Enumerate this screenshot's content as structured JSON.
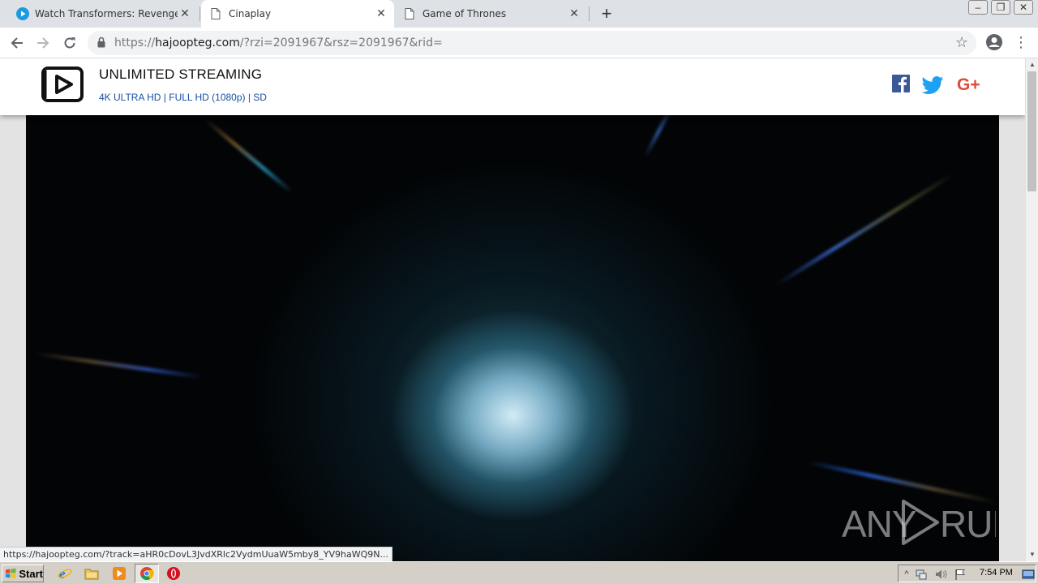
{
  "browser": {
    "tabs": [
      {
        "title": "Watch Transformers: Revenge Of Th",
        "icon": "play-circle-icon",
        "active": false
      },
      {
        "title": "Cinaplay",
        "icon": "page-icon",
        "active": true
      },
      {
        "title": "Game of Thrones",
        "icon": "page-icon",
        "active": false
      }
    ],
    "address": {
      "scheme": "https://",
      "host": "hajoopteg.com",
      "path": "/?rzi=2091967&rsz=2091967&rid="
    },
    "status_url": "https://hajoopteg.com/?track=aHR0cDovL3JvdXRlc2VydmUuaW5mby8_YV9haWQ9N..."
  },
  "site": {
    "title": "UNLIMITED STREAMING",
    "subtitle": "4K ULTRA HD | FULL HD (1080p) | SD",
    "social": [
      "facebook-icon",
      "twitter-icon",
      "google-plus-icon"
    ]
  },
  "watermark": "ANY RUN",
  "taskbar": {
    "start_label": "Start",
    "apps": [
      "internet-explorer-icon",
      "file-explorer-icon",
      "media-player-icon",
      "chrome-icon",
      "opera-icon"
    ],
    "clock": "7:54 PM"
  },
  "colors": {
    "site_accent": "#1b4fa0",
    "facebook": "#3b5998",
    "twitter": "#1da1f2",
    "google_plus": "#dd4b39"
  }
}
